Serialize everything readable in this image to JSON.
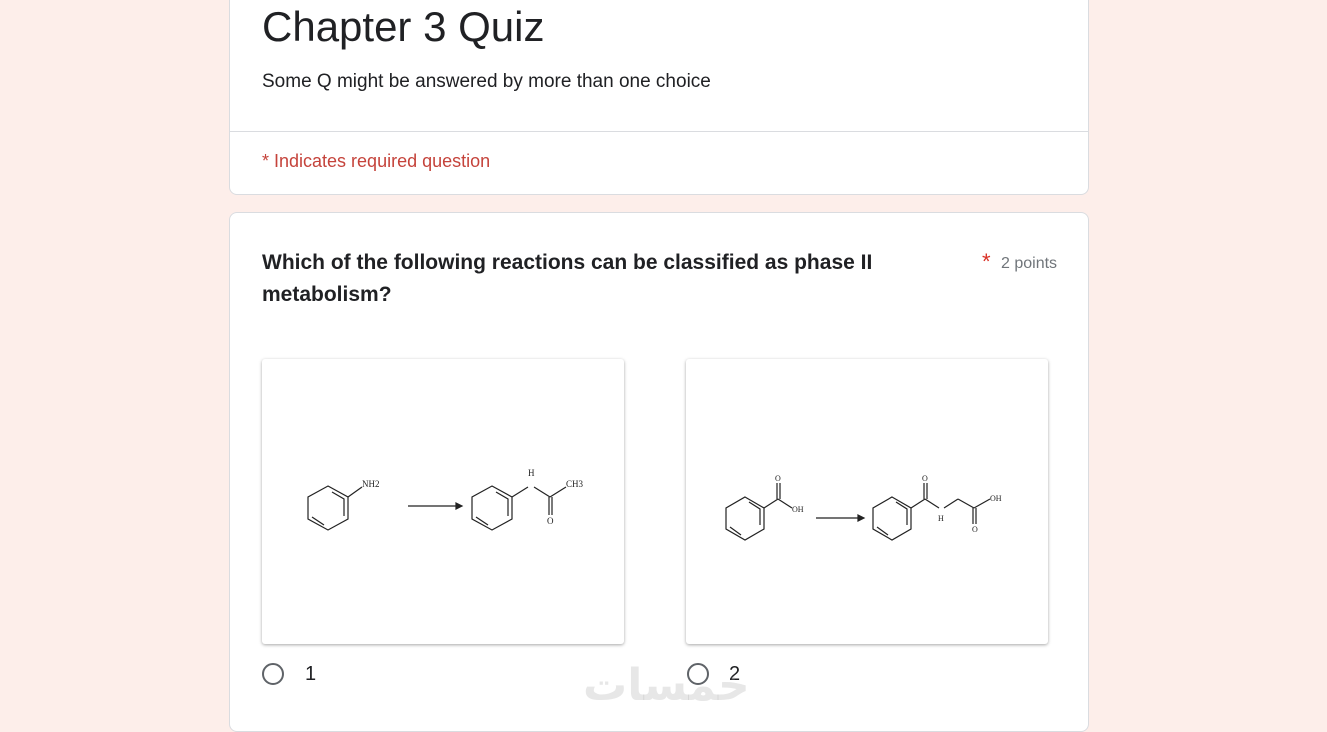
{
  "form": {
    "title": "Chapter 3 Quiz",
    "description": "Some Q might be answered by more than one choice",
    "required_note": "* Indicates required question"
  },
  "question": {
    "title": "Which of the following reactions can be classified as phase II metabolism?",
    "required_mark": "*",
    "points": "2 points",
    "options": [
      {
        "label": "1",
        "image_labels": {
          "reactant_group": "NH2",
          "product_n": "H",
          "product_o": "O",
          "product_ch3": "CH3"
        }
      },
      {
        "label": "2",
        "image_labels": {
          "reactant_o": "O",
          "reactant_oh": "OH",
          "product_o": "O",
          "product_h": "H",
          "product_oh": "OH",
          "product_o2": "O"
        }
      }
    ]
  },
  "watermark": "خمسات",
  "colors": {
    "background": "#fdeeea",
    "required": "#c5433b",
    "text": "#202124"
  }
}
